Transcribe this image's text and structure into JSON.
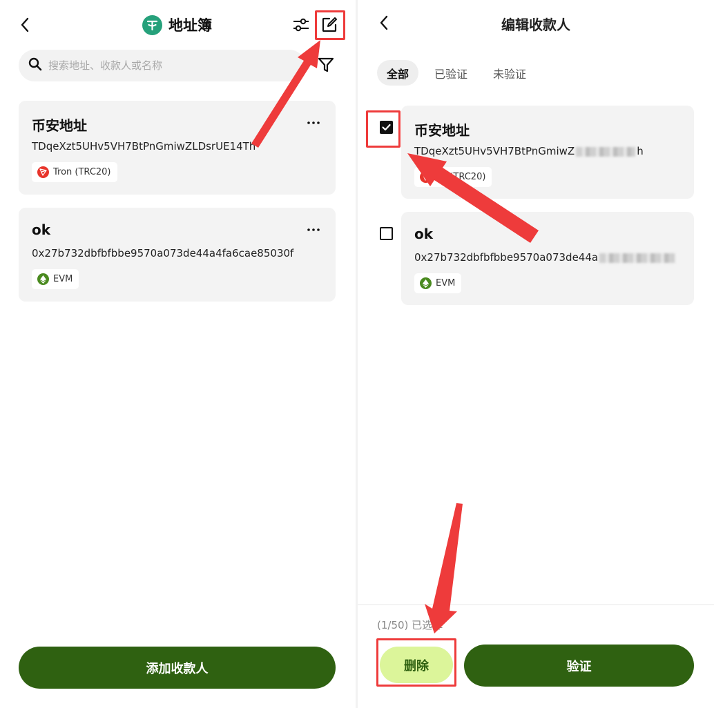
{
  "colors": {
    "brand_green": "#2f6111",
    "delete_bg": "#dcf59a",
    "annotation_red": "#ee3b3b",
    "tron_red": "#e8342b",
    "evm_green": "#4a8a1f",
    "usdt_green": "#26a17b"
  },
  "left": {
    "title": "地址簿",
    "search": {
      "placeholder": "搜索地址、收款人或名称",
      "value": ""
    },
    "icons": [
      "back-icon",
      "usdt-icon",
      "sliders-icon",
      "edit-icon",
      "search-icon",
      "filter-icon",
      "more-icon"
    ],
    "cards": [
      {
        "name": "币安地址",
        "address": "TDqeXzt5UHv5VH7BtPnGmiwZLDsrUE14Th",
        "network": "Tron (TRC20)"
      },
      {
        "name": "ok",
        "address": "0x27b732dbfbfbbe9570a073de44a4fa6cae85030f",
        "network": "EVM"
      }
    ],
    "add_button": "添加收款人"
  },
  "right": {
    "title": "编辑收款人",
    "tabs": [
      {
        "label": "全部",
        "active": true
      },
      {
        "label": "已验证",
        "active": false
      },
      {
        "label": "未验证",
        "active": false
      }
    ],
    "cards": [
      {
        "name": "币安地址",
        "address_visible": "TDqeXzt5UHv5VH7BtPnGmiwZ",
        "address_tail": "h",
        "network": "on (TRC20)",
        "checked": true
      },
      {
        "name": "ok",
        "address_visible": "0x27b732dbfbfbbe9570a073de44a",
        "address_tail": "",
        "network": "EVM",
        "checked": false
      }
    ],
    "selected_count": "(1/50) 已选择",
    "delete_button": "删除",
    "verify_button": "验证"
  }
}
